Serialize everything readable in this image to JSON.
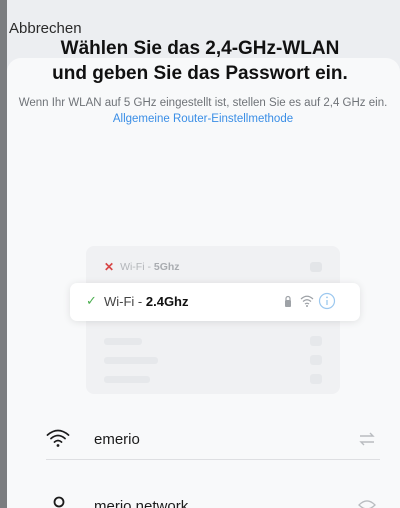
{
  "header": {
    "cancel_label": "Abbrechen"
  },
  "main": {
    "title_line1": "Wählen Sie das 2,4-GHz-WLAN",
    "title_line2": "und geben Sie das Passwort ein.",
    "description": "Wenn Ihr WLAN auf 5 GHz eingestellt ist, stellen Sie es auf 2,4 GHz ein.",
    "description_link": "Allgemeine Router-Einstellmethode"
  },
  "illustration": {
    "row_5ghz": {
      "prefix": "Wi-Fi - ",
      "band": "5Ghz",
      "status_icon": "x-icon",
      "status_color": "#d74545"
    },
    "row_24ghz": {
      "prefix": "Wi-Fi - ",
      "band": "2.4Ghz",
      "status_icon": "check-icon",
      "status_color": "#4caf50"
    }
  },
  "form": {
    "wifi_name": "emerio",
    "password": "merio network",
    "wifi_icon": "wifi-icon",
    "password_icon": "key-icon",
    "accent": "#3a8ee6"
  }
}
